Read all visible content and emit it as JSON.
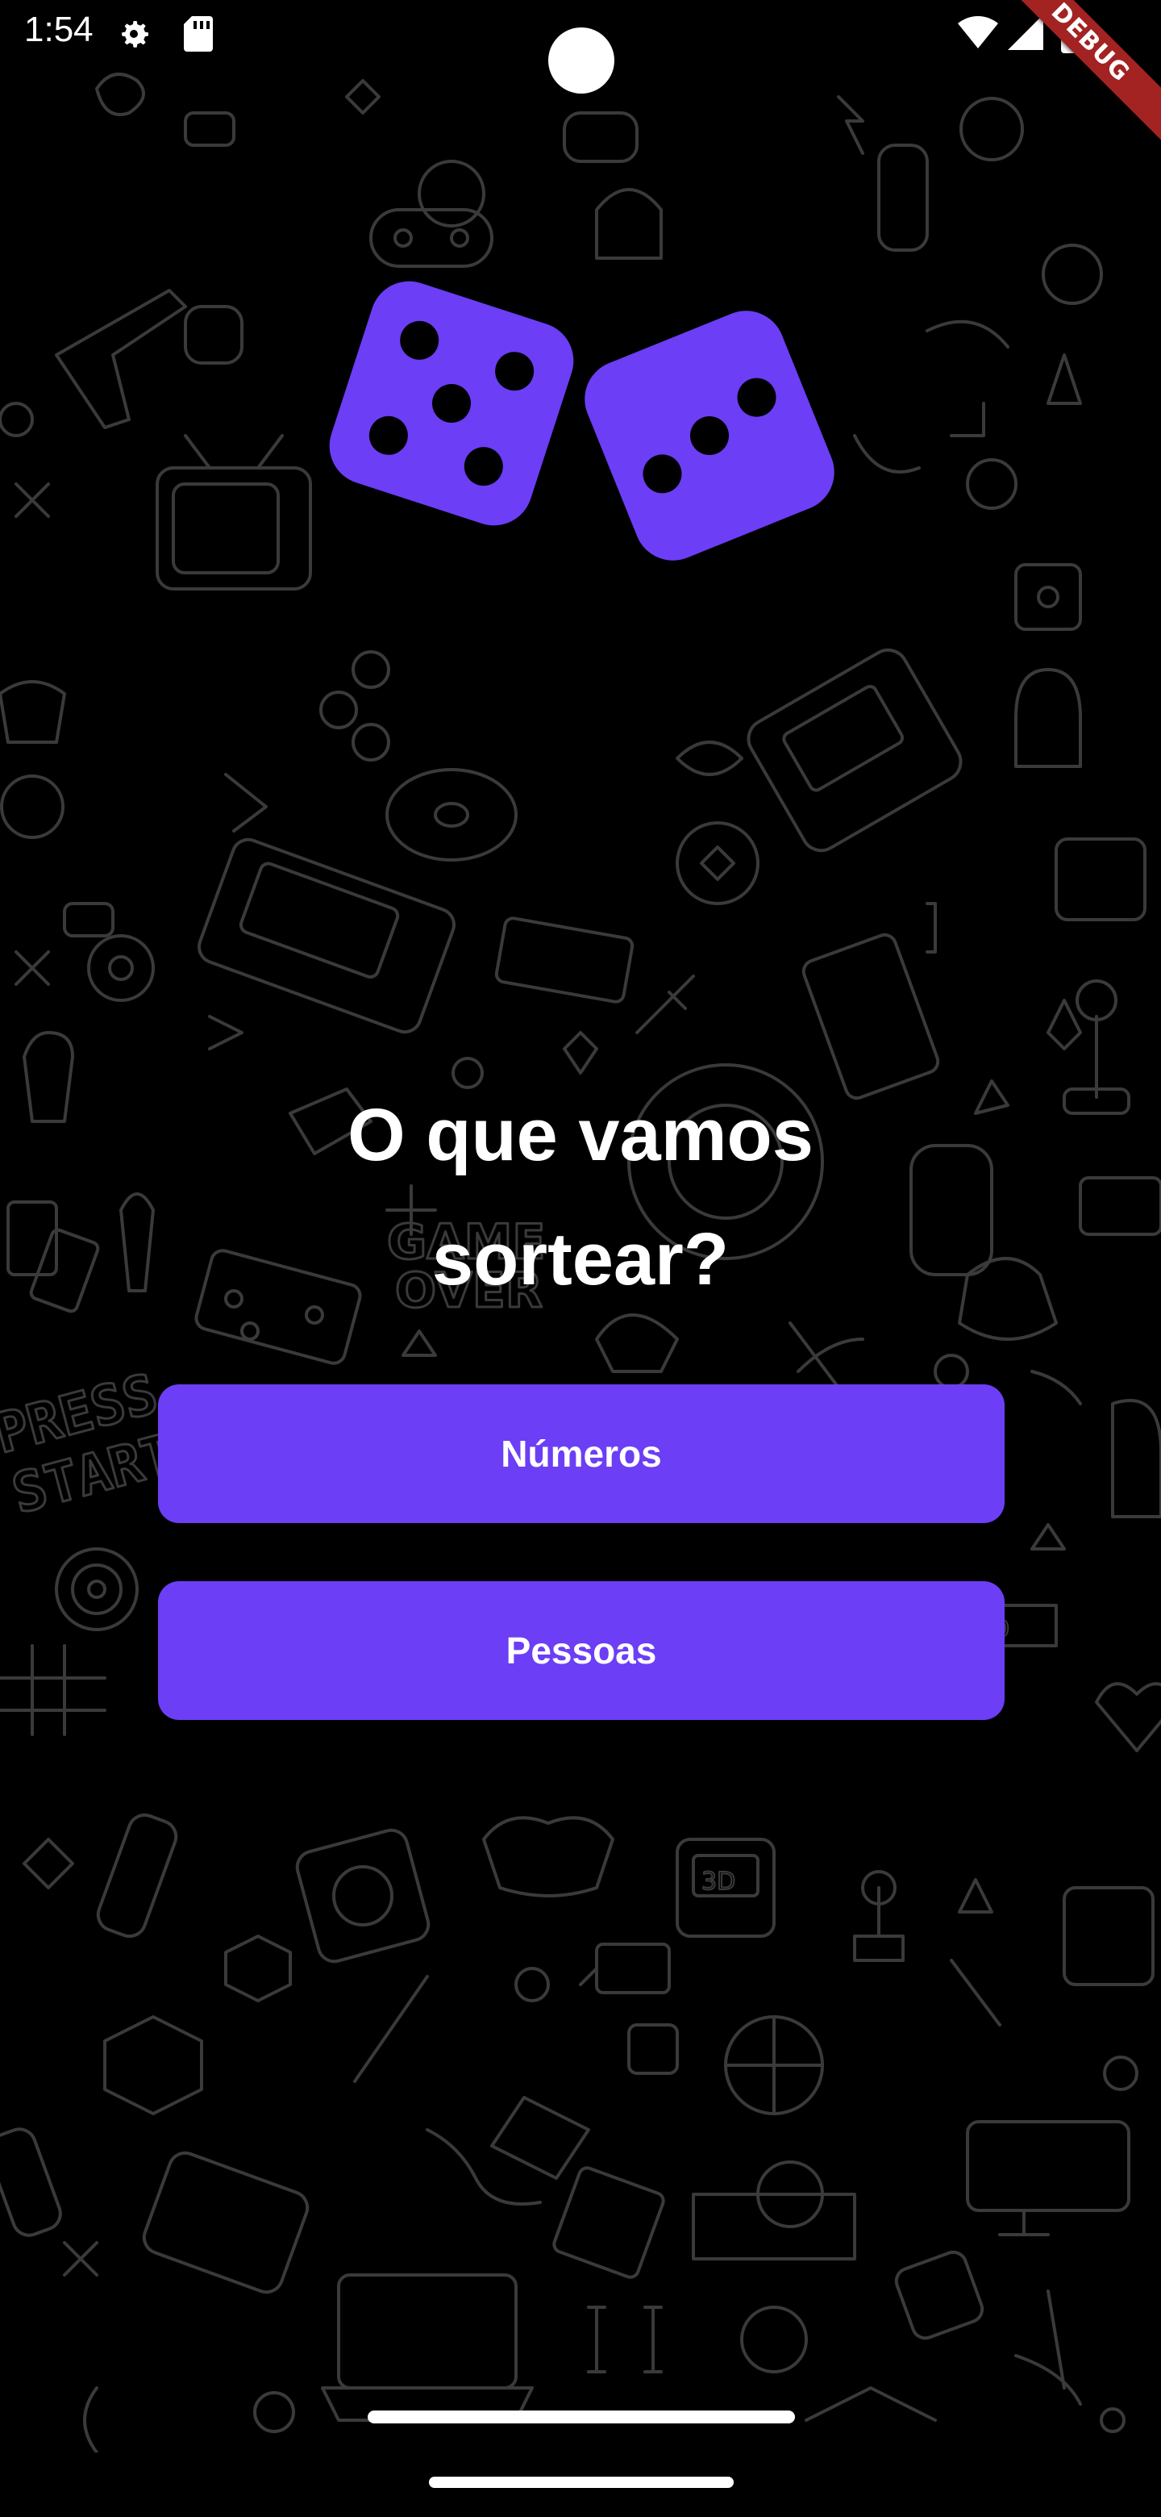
{
  "status_bar": {
    "time": "1:54",
    "icons": [
      "settings-icon",
      "sd-card-icon",
      "wifi-icon",
      "signal-icon",
      "battery-icon"
    ]
  },
  "debug_banner": "DEBUG",
  "background": {
    "pattern": "gaming-doodles",
    "pattern_color": "#3a3a3a"
  },
  "logo": {
    "icon": "dice-icon",
    "color": "#6c3ef5"
  },
  "title": {
    "line1": "O que vamos",
    "line2": "sortear?"
  },
  "buttons": {
    "numbers_label": "Números",
    "people_label": "Pessoas"
  },
  "colors": {
    "accent": "#6c3ef5",
    "background": "#000000",
    "text": "#ffffff"
  }
}
